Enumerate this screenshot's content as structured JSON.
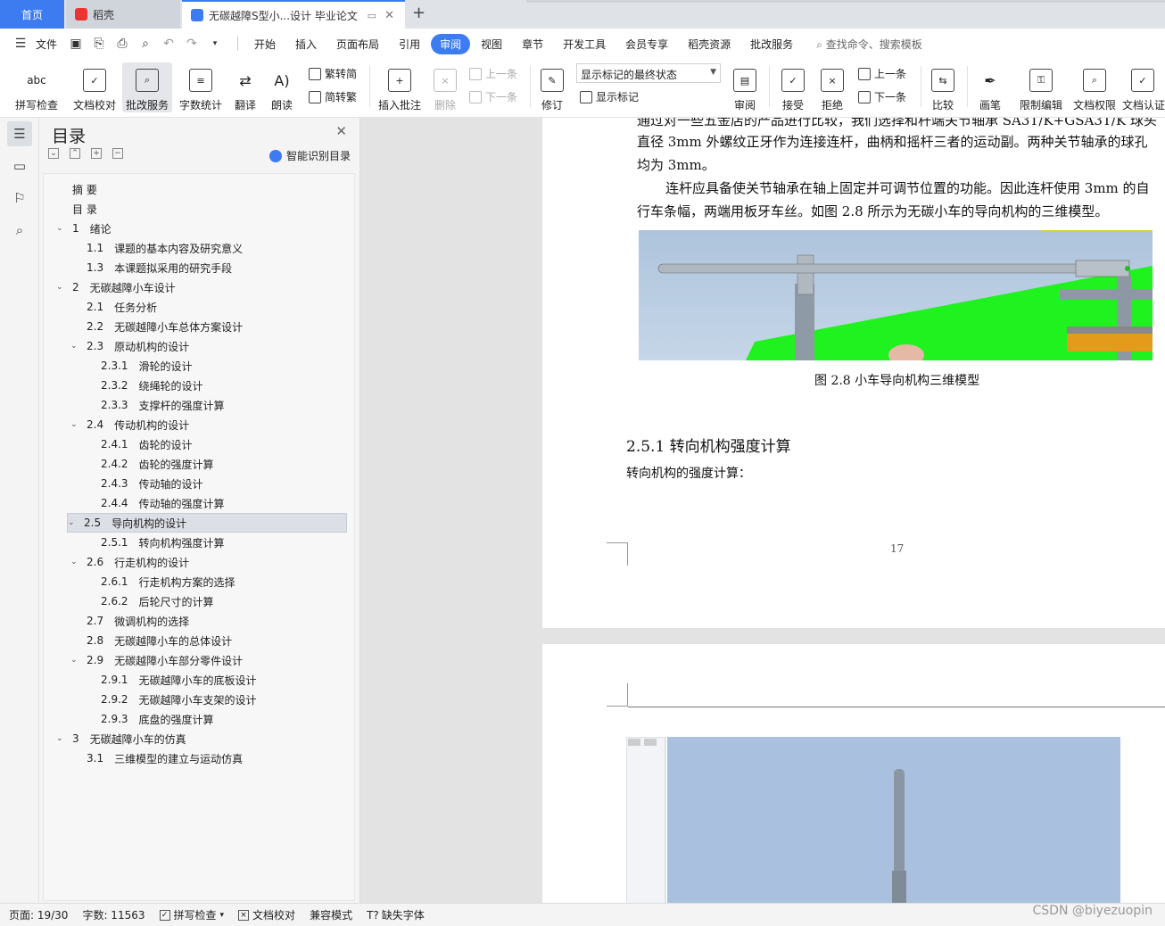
{
  "tabs": {
    "home": "首页",
    "doc1": "稻壳",
    "doc2": "无碳越障S型小...设计 毕业论文"
  },
  "menu": {
    "file": "文件",
    "items": [
      "开始",
      "插入",
      "页面布局",
      "引用",
      "审阅",
      "视图",
      "章节",
      "开发工具",
      "会员专享",
      "稻壳资源",
      "批改服务"
    ],
    "active": "审阅",
    "search": "查找命令、搜索模板"
  },
  "ribbon": {
    "spell_icon": "abc",
    "spell": "拼写检查",
    "doc_check": "文档校对",
    "correct_service": "批改服务",
    "word_count": "字数统计",
    "translate": "翻译",
    "read_aloud": "朗读",
    "trad_to_simp": "繁转简",
    "simp_to_trad": "简转繁",
    "insert_comment": "插入批注",
    "delete": "删除",
    "prev": "上一条",
    "next": "下一条",
    "revise": "修订",
    "markup_state": "显示标记的最终状态",
    "show_markup": "显示标记",
    "review": "审阅",
    "accept": "接受",
    "reject": "拒绝",
    "prev2": "上一条",
    "next2": "下一条",
    "compare": "比较",
    "pen": "画笔",
    "restrict_edit": "限制编辑",
    "doc_rights": "文档权限",
    "doc_cert": "文档认证"
  },
  "toc": {
    "title": "目录",
    "smart": "智能识别目录",
    "items": [
      {
        "num": "摘  要",
        "text": "",
        "level": 0,
        "chev": ""
      },
      {
        "num": "目  录",
        "text": "",
        "level": 0,
        "chev": ""
      },
      {
        "num": "1",
        "text": "绪论",
        "level": 0,
        "chev": "v"
      },
      {
        "num": "1.1",
        "text": "课题的基本内容及研究意义",
        "level": 1,
        "chev": ""
      },
      {
        "num": "1.3",
        "text": "本课题拟采用的研究手段",
        "level": 1,
        "chev": ""
      },
      {
        "num": "2",
        "text": "无碳越障小车设计",
        "level": 0,
        "chev": "v"
      },
      {
        "num": "2.1",
        "text": "任务分析",
        "level": 1,
        "chev": ""
      },
      {
        "num": "2.2",
        "text": "无碳越障小车总体方案设计",
        "level": 1,
        "chev": ""
      },
      {
        "num": "2.3",
        "text": "原动机构的设计",
        "level": 1,
        "chev": "v"
      },
      {
        "num": "2.3.1",
        "text": "滑轮的设计",
        "level": 2,
        "chev": ""
      },
      {
        "num": "2.3.2",
        "text": "绕绳轮的设计",
        "level": 2,
        "chev": ""
      },
      {
        "num": "2.3.3",
        "text": "支撑杆的强度计算",
        "level": 2,
        "chev": ""
      },
      {
        "num": "2.4",
        "text": "传动机构的设计",
        "level": 1,
        "chev": "v"
      },
      {
        "num": "2.4.1",
        "text": "齿轮的设计",
        "level": 2,
        "chev": ""
      },
      {
        "num": "2.4.2",
        "text": "齿轮的强度计算",
        "level": 2,
        "chev": ""
      },
      {
        "num": "2.4.3",
        "text": "传动轴的设计",
        "level": 2,
        "chev": ""
      },
      {
        "num": "2.4.4",
        "text": "传动轴的强度计算",
        "level": 2,
        "chev": ""
      },
      {
        "num": "2.5",
        "text": "导向机构的设计",
        "level": 1,
        "chev": "v",
        "selected": true
      },
      {
        "num": "2.5.1",
        "text": "转向机构强度计算",
        "level": 2,
        "chev": ""
      },
      {
        "num": "2.6",
        "text": "行走机构的设计",
        "level": 1,
        "chev": "v"
      },
      {
        "num": "2.6.1",
        "text": "行走机构方案的选择",
        "level": 2,
        "chev": ""
      },
      {
        "num": "2.6.2",
        "text": "后轮尺寸的计算",
        "level": 2,
        "chev": ""
      },
      {
        "num": "2.7",
        "text": "微调机构的选择",
        "level": 1,
        "chev": ""
      },
      {
        "num": "2.8",
        "text": "无碳越障小车的总体设计",
        "level": 1,
        "chev": ""
      },
      {
        "num": "2.9",
        "text": "无碳越障小车部分零件设计",
        "level": 1,
        "chev": "v"
      },
      {
        "num": "2.9.1",
        "text": "无碳越障小车的底板设计",
        "level": 2,
        "chev": ""
      },
      {
        "num": "2.9.2",
        "text": "无碳越障小车支架的设计",
        "level": 2,
        "chev": ""
      },
      {
        "num": "2.9.3",
        "text": "底盘的强度计算",
        "level": 2,
        "chev": ""
      },
      {
        "num": "3",
        "text": "无碳越障小车的仿真",
        "level": 0,
        "chev": "v"
      },
      {
        "num": "3.1",
        "text": "三维模型的建立与运动仿真",
        "level": 1,
        "chev": ""
      }
    ]
  },
  "doc": {
    "line0": "通过对一些五金店的产品进行比较，我们选择和杆端关节轴承 SA3T/K+GSA3T/K 球头",
    "line1": "直径 3mm 外螺纹正牙作为连接连杆，曲柄和摇杆三者的运动副。两种关节轴承的球孔",
    "line2": "均为 3mm。",
    "line3": "连杆应具备使关节轴承在轴上固定并可调节位置的功能。因此连杆使用 3mm 的自",
    "line4": "行车条幅，两端用板牙车丝。如图 2.8 所示为无碳小车的导向机构的三维模型。",
    "caption": "图 2.8  小车导向机构三维模型",
    "heading": "2.5.1    转向机构强度计算",
    "body": "转向机构的强度计算：",
    "page_number": "17"
  },
  "status": {
    "page": "页面: 19/30",
    "words": "字数: 11563",
    "spell": "拼写检查",
    "doc_check": "文档校对",
    "compat": "兼容模式",
    "missing_font": "缺失字体"
  },
  "watermark": "CSDN @biyezuopin"
}
